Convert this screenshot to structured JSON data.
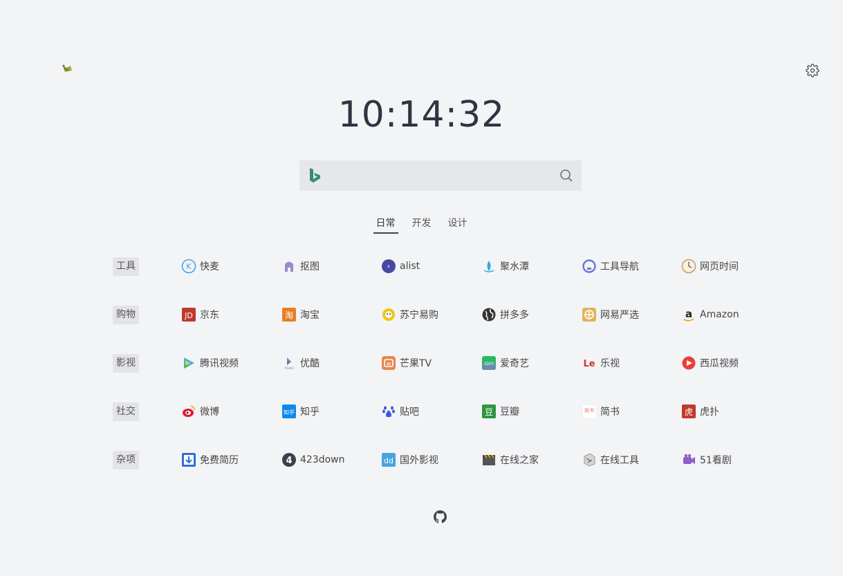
{
  "clock": "10:14:32",
  "search": {
    "placeholder": ""
  },
  "tabs": [
    {
      "label": "日常",
      "active": true
    },
    {
      "label": "开发",
      "active": false
    },
    {
      "label": "设计",
      "active": false
    }
  ],
  "categories": [
    {
      "label": "工具",
      "links": [
        {
          "label": "快麦",
          "icon": "kuaimai-icon",
          "color": "#4a9fe0"
        },
        {
          "label": "抠图",
          "icon": "koutu-icon",
          "color": "#9a8bd1"
        },
        {
          "label": "alist",
          "icon": "alist-icon",
          "color": "#4a47a3"
        },
        {
          "label": "聚水潭",
          "icon": "jushuitan-icon",
          "color": "#33a8e0"
        },
        {
          "label": "工具导航",
          "icon": "tool-nav-icon",
          "color": "#6b73d6"
        },
        {
          "label": "网页时间",
          "icon": "clock-icon",
          "color": "#c79b57"
        }
      ]
    },
    {
      "label": "购物",
      "links": [
        {
          "label": "京东",
          "icon": "jd-icon",
          "color": "#c0392b"
        },
        {
          "label": "淘宝",
          "icon": "taobao-icon",
          "color": "#e67e22"
        },
        {
          "label": "苏宁易购",
          "icon": "suning-icon",
          "color": "#f1c40f"
        },
        {
          "label": "拼多多",
          "icon": "globe-icon",
          "color": "#333333"
        },
        {
          "label": "网易严选",
          "icon": "yanxuan-icon",
          "color": "#e0b35b"
        },
        {
          "label": "Amazon",
          "icon": "amazon-icon",
          "color": "#222222"
        }
      ]
    },
    {
      "label": "影视",
      "links": [
        {
          "label": "腾讯视频",
          "icon": "tencent-video-icon",
          "color": "#2fb6f3"
        },
        {
          "label": "优酷",
          "icon": "youku-icon",
          "color": "#2aa1e8"
        },
        {
          "label": "芒果TV",
          "icon": "mgtv-icon",
          "color": "#e6874a"
        },
        {
          "label": "爱奇艺",
          "icon": "iqiyi-icon",
          "color": "#29b960"
        },
        {
          "label": "乐视",
          "icon": "letv-icon",
          "color": "#d0342c"
        },
        {
          "label": "西瓜视频",
          "icon": "xigua-icon",
          "color": "#e8413c"
        }
      ]
    },
    {
      "label": "社交",
      "links": [
        {
          "label": "微博",
          "icon": "weibo-icon",
          "color": "#e6162d"
        },
        {
          "label": "知乎",
          "icon": "zhihu-icon",
          "color": "#0f88eb"
        },
        {
          "label": "贴吧",
          "icon": "tieba-icon",
          "color": "#3a5bd9"
        },
        {
          "label": "豆瓣",
          "icon": "douban-icon",
          "color": "#2e963d"
        },
        {
          "label": "简书",
          "icon": "jianshu-icon",
          "color": "#ea6f5a"
        },
        {
          "label": "虎扑",
          "icon": "hupu-icon",
          "color": "#c0392b"
        }
      ]
    },
    {
      "label": "杂项",
      "links": [
        {
          "label": "免费简历",
          "icon": "download-icon",
          "color": "#2d6fd6"
        },
        {
          "label": "423down",
          "icon": "423down-icon",
          "color": "#3a4150"
        },
        {
          "label": "国外影视",
          "icon": "dd-icon",
          "color": "#4aa3df"
        },
        {
          "label": "在线之家",
          "icon": "clapper-icon",
          "color": "#555555"
        },
        {
          "label": "在线工具",
          "icon": "tools-icon",
          "color": "#999999"
        },
        {
          "label": "51看剧",
          "icon": "51kanju-icon",
          "color": "#8e5ec9"
        }
      ]
    }
  ]
}
